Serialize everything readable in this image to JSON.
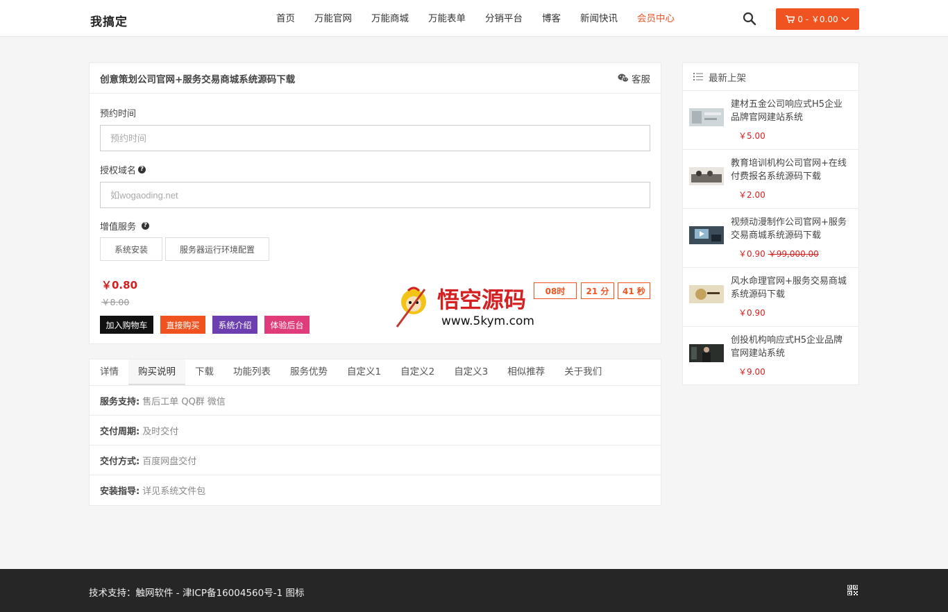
{
  "header": {
    "logo": "我搞定",
    "nav": [
      "首页",
      "万能官网",
      "万能商城",
      "万能表单",
      "分销平台",
      "博客",
      "新闻快讯"
    ],
    "member": "会员中心",
    "cart": "0 - ￥0.00",
    "accent": "#f0531f"
  },
  "product": {
    "title": "创意策划公司官网+服务交易商城系统源码下载",
    "kefu": "客服",
    "f1_label": "预约时间",
    "f1_placeholder": "预约时间",
    "f2_label": "授权域名",
    "f2_placeholder": "如wogaoding.net",
    "f3_label": "增值服务",
    "options": [
      "系统安装",
      "服务器运行环境配置"
    ],
    "price": "￥0.80",
    "old_price": "￥8.00",
    "buttons": [
      "加入购物车",
      "直接购买",
      "系统介绍",
      "体验后台"
    ],
    "countdown": [
      "08时",
      "21 分",
      "41 秒"
    ]
  },
  "tabs": [
    "详情",
    "购买说明",
    "下载",
    "功能列表",
    "服务优势",
    "自定义1",
    "自定义2",
    "自定义3",
    "相似推荐",
    "关于我们"
  ],
  "rows": [
    {
      "k": "服务支持:",
      "v": "售后工单 QQ群 微信"
    },
    {
      "k": "交付周期:",
      "v": "及时交付"
    },
    {
      "k": "交付方式:",
      "v": "百度网盘交付"
    },
    {
      "k": "安装指导:",
      "v": "详见系统文件包"
    }
  ],
  "sidebar": {
    "title": "最新上架",
    "items": [
      {
        "title": "建材五金公司响应式H5企业品牌官网建站系统",
        "price": "￥5.00",
        "old": ""
      },
      {
        "title": "教育培训机构公司官网+在线付费报名系统源码下载",
        "price": "￥2.00",
        "old": ""
      },
      {
        "title": "视频动漫制作公司官网+服务交易商城系统源码下载",
        "price": "￥0.90",
        "old": "￥99,000.00"
      },
      {
        "title": "风水命理官网+服务交易商城系统源码下载",
        "price": "￥0.90",
        "old": ""
      },
      {
        "title": "创投机构响应式H5企业品牌官网建站系统",
        "price": "￥9.00",
        "old": ""
      }
    ]
  },
  "footer": {
    "text": "技术支持：触网软件 - 津ICP备16004560号-1   图标"
  },
  "watermark": {
    "title": "悟空源码",
    "url": "www.5kym.com"
  }
}
